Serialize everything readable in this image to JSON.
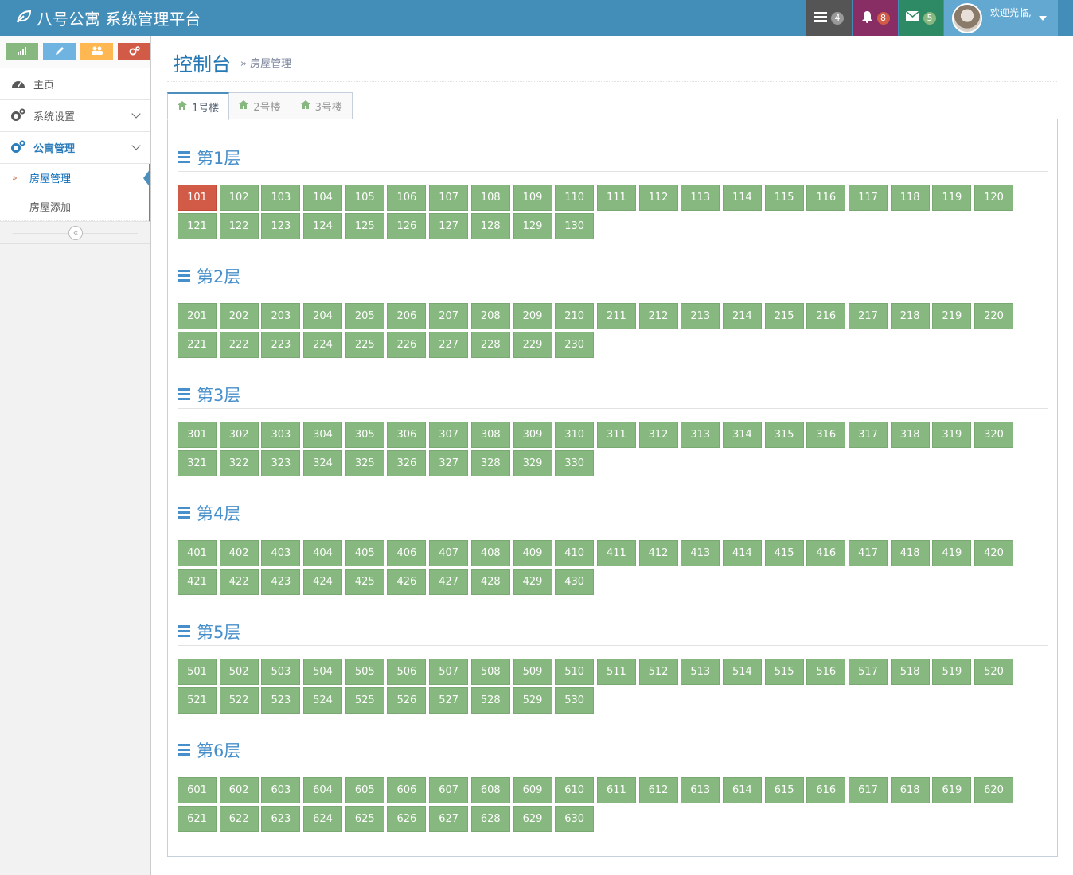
{
  "app": {
    "title": "八号公寓 系统管理平台"
  },
  "navbar": {
    "tasks_count": "4",
    "notifications_count": "8",
    "messages_count": "5",
    "welcome": "欢迎光临,"
  },
  "sidebar": {
    "menu": [
      {
        "label": "主页",
        "icon": "dashboard-icon"
      },
      {
        "label": "系统设置",
        "icon": "cogs-icon"
      },
      {
        "label": "公寓管理",
        "icon": "cogs-icon"
      }
    ],
    "submenu": [
      {
        "label": "房屋管理",
        "active": true
      },
      {
        "label": "房屋添加",
        "active": false
      }
    ]
  },
  "header": {
    "title": "控制台",
    "breadcrumb": "房屋管理"
  },
  "tabs": [
    {
      "label": "1号楼",
      "active": true
    },
    {
      "label": "2号楼",
      "active": false
    },
    {
      "label": "3号楼",
      "active": false
    }
  ],
  "floors": [
    {
      "label": "第1层",
      "rooms": [
        "101",
        "102",
        "103",
        "104",
        "105",
        "106",
        "107",
        "108",
        "109",
        "110",
        "111",
        "112",
        "113",
        "114",
        "115",
        "116",
        "117",
        "118",
        "119",
        "120",
        "121",
        "122",
        "123",
        "124",
        "125",
        "126",
        "127",
        "128",
        "129",
        "130"
      ]
    },
    {
      "label": "第2层",
      "rooms": [
        "201",
        "202",
        "203",
        "204",
        "205",
        "206",
        "207",
        "208",
        "209",
        "210",
        "211",
        "212",
        "213",
        "214",
        "215",
        "216",
        "217",
        "218",
        "219",
        "220",
        "221",
        "222",
        "223",
        "224",
        "225",
        "226",
        "227",
        "228",
        "229",
        "230"
      ]
    },
    {
      "label": "第3层",
      "rooms": [
        "301",
        "302",
        "303",
        "304",
        "305",
        "306",
        "307",
        "308",
        "309",
        "310",
        "311",
        "312",
        "313",
        "314",
        "315",
        "316",
        "317",
        "318",
        "319",
        "320",
        "321",
        "322",
        "323",
        "324",
        "325",
        "326",
        "327",
        "328",
        "329",
        "330"
      ]
    },
    {
      "label": "第4层",
      "rooms": [
        "401",
        "402",
        "403",
        "404",
        "405",
        "406",
        "407",
        "408",
        "409",
        "410",
        "411",
        "412",
        "413",
        "414",
        "415",
        "416",
        "417",
        "418",
        "419",
        "420",
        "421",
        "422",
        "423",
        "424",
        "425",
        "426",
        "427",
        "428",
        "429",
        "430"
      ]
    },
    {
      "label": "第5层",
      "rooms": [
        "501",
        "502",
        "503",
        "504",
        "505",
        "506",
        "507",
        "508",
        "509",
        "510",
        "511",
        "512",
        "513",
        "514",
        "515",
        "516",
        "517",
        "518",
        "519",
        "520",
        "521",
        "522",
        "523",
        "524",
        "525",
        "526",
        "527",
        "528",
        "529",
        "530"
      ]
    },
    {
      "label": "第6层",
      "rooms": [
        "601",
        "602",
        "603",
        "604",
        "605",
        "606",
        "607",
        "608",
        "609",
        "610",
        "611",
        "612",
        "613",
        "614",
        "615",
        "616",
        "617",
        "618",
        "619",
        "620",
        "621",
        "622",
        "623",
        "624",
        "625",
        "626",
        "627",
        "628",
        "629",
        "630"
      ]
    }
  ],
  "occupied_rooms": [
    "101"
  ],
  "colors": {
    "vacant": "#87b87f",
    "occupied": "#d15b47",
    "navbar": "#438eb9"
  }
}
